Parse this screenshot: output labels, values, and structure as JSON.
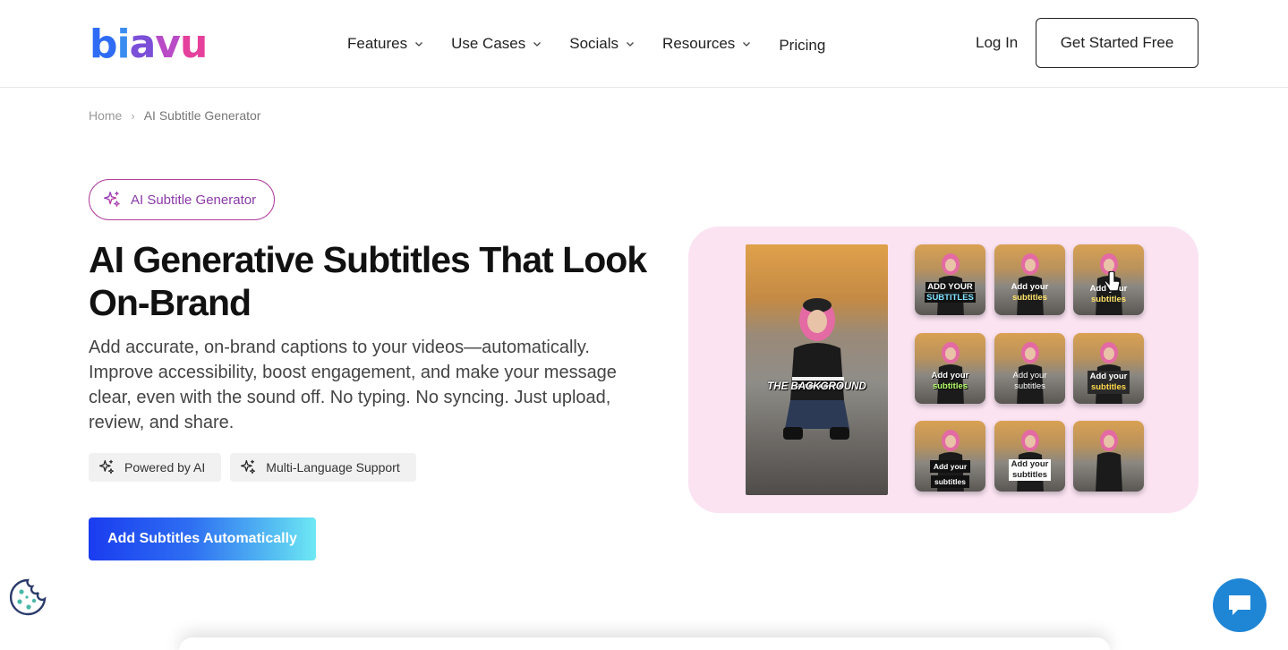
{
  "brand": {
    "logo_text": "biavu",
    "logo_letters": [
      "b",
      "i",
      "a",
      "v",
      "u"
    ]
  },
  "nav": {
    "items": [
      {
        "label": "Features",
        "has_dropdown": true
      },
      {
        "label": "Use Cases",
        "has_dropdown": true
      },
      {
        "label": "Socials",
        "has_dropdown": true
      },
      {
        "label": "Resources",
        "has_dropdown": true
      },
      {
        "label": "Pricing",
        "has_dropdown": false
      }
    ],
    "login_label": "Log In",
    "cta_label": "Get Started Free"
  },
  "breadcrumb": {
    "home": "Home",
    "current": "AI Subtitle Generator"
  },
  "hero": {
    "pill_label": "AI Subtitle Generator",
    "headline_line1": "AI Generative Subtitles That Look",
    "headline_line2": "On-Brand",
    "description": "Add accurate, on-brand captions to your videos—automatically. Improve accessibility, boost engagement, and make your message clear, even with the sound off. No typing. No syncing. Just upload, review, and share.",
    "tags": [
      "Powered by AI",
      "Multi-Language Support"
    ],
    "cta_label": "Add Subtitles Automatically"
  },
  "visual": {
    "main_caption": "THE BACKGROUND",
    "thumbnails": [
      {
        "line1": "ADD YOUR",
        "line2": "SUBTITLES"
      },
      {
        "line1": "Add your",
        "line2": "subtitles"
      },
      {
        "line1": "Add your",
        "line2": "subtitles"
      },
      {
        "line1": "Add your",
        "line2": "subtitles"
      },
      {
        "line1": "Add your",
        "line2": "subtitles"
      },
      {
        "line1": "Add your",
        "line2": "subtitles"
      },
      {
        "line1": "Add your",
        "line2": "subtitles"
      },
      {
        "line1": "Add your",
        "line2": "subtitles"
      },
      {
        "line1": "",
        "line2": ""
      }
    ]
  },
  "colors": {
    "accent_purple": "#b03e9b",
    "cta_gradient_start": "#1a3cf0",
    "cta_gradient_end": "#6ee8f4",
    "hero_card_bg": "#fbe3f2",
    "chat_blue": "#1f86d6"
  },
  "icons": {
    "sparkle": "sparkle-icon",
    "chevron": "chevron-down-icon",
    "cookie": "cookie-icon",
    "chat": "chat-icon"
  }
}
